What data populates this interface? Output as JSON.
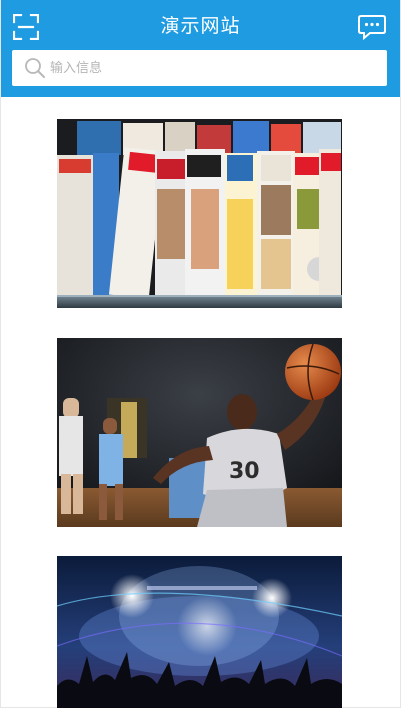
{
  "header": {
    "title": "演示网站",
    "scan_icon": "scan-icon",
    "message_icon": "message-icon",
    "background": "#1e9be1"
  },
  "search": {
    "placeholder": "输入信息",
    "value": ""
  },
  "feed": [
    {
      "name": "magazines-image"
    },
    {
      "name": "basketball-image"
    },
    {
      "name": "concert-image"
    }
  ]
}
